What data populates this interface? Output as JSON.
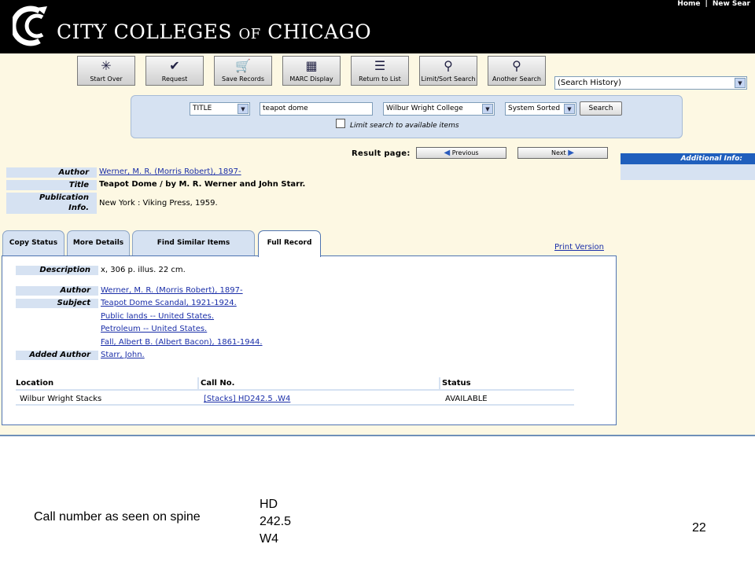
{
  "header": {
    "logo_main": "CITY COLLEGES",
    "logo_of": "OF",
    "logo_city": "CHICAGO",
    "toplinks": [
      "Home",
      "|",
      "New Sear"
    ]
  },
  "toolbar": [
    {
      "label": "Start Over",
      "icon": "start-over-icon",
      "glyph": "✳"
    },
    {
      "label": "Request",
      "icon": "request-icon",
      "glyph": "✔"
    },
    {
      "label": "Save Records",
      "icon": "cart-icon",
      "glyph": "🛒"
    },
    {
      "label": "MARC Display",
      "icon": "marc-icon",
      "glyph": "▦"
    },
    {
      "label": "Return to List",
      "icon": "return-list-icon",
      "glyph": "☰"
    },
    {
      "label": "Limit/Sort Search",
      "icon": "limit-sort-icon",
      "glyph": "⚲"
    },
    {
      "label": "Another Search",
      "icon": "magnifier-icon",
      "glyph": "⚲"
    }
  ],
  "search_history": "(Search History)",
  "search": {
    "type": "TITLE",
    "query": "teapot dome",
    "location": "Wilbur Wright College",
    "sort": "System Sorted",
    "button": "Search",
    "limit_label": "Limit search to available items"
  },
  "results": {
    "label": "Result page:",
    "previous": "Previous",
    "next": "Next",
    "additional_info": "Additional Info:"
  },
  "bib": {
    "author_label": "Author",
    "author": "Werner, M. R. (Morris Robert), 1897-",
    "title_label": "Title",
    "title": "Teapot Dome / by M. R. Werner and John Starr.",
    "pub_label_1": "Publication",
    "pub_label_2": "Info.",
    "publication": "New York : Viking Press, 1959."
  },
  "tabs": [
    "Copy Status",
    "More Details",
    "Find Similar Items",
    "Full Record"
  ],
  "print_version": "Print Version",
  "record": {
    "description_label": "Description",
    "description": "x, 306 p. illus. 22 cm.",
    "author_label": "Author",
    "author": "Werner, M. R. (Morris Robert), 1897-",
    "subject_label": "Subject",
    "subjects": [
      "Teapot Dome Scandal, 1921-1924.",
      "Public lands -- United States.",
      "Petroleum -- United States.",
      "Fall, Albert B. (Albert Bacon), 1861-1944."
    ],
    "added_author_label": "Added Author",
    "added_author": "Starr, John."
  },
  "holdings": {
    "headers": [
      "Location",
      "Call No.",
      "Status"
    ],
    "location": "Wilbur Wright Stacks",
    "call_no": "[Stacks] HD242.5 .W4",
    "status": "AVAILABLE"
  },
  "slide": {
    "caption": "Call number as seen on spine",
    "spine": [
      "HD",
      "242.5",
      "W4"
    ],
    "page_number": "22"
  }
}
